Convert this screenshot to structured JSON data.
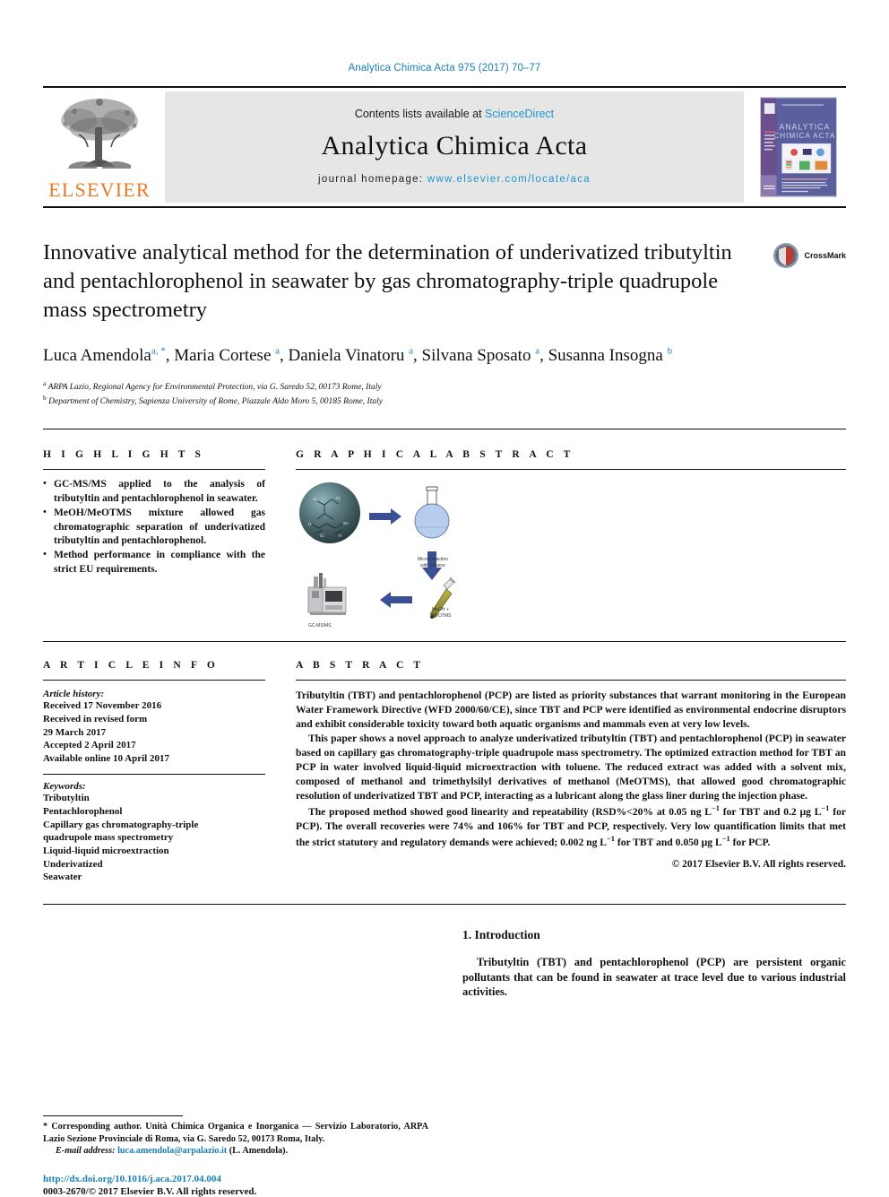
{
  "running_head": "Analytica Chimica Acta 975 (2017) 70–77",
  "masthead": {
    "elsevier_wordmark": "ELSEVIER",
    "contents_prefix": "Contents lists available at ",
    "contents_link": "ScienceDirect",
    "journal_name": "Analytica Chimica Acta",
    "homepage_prefix": "journal homepage: ",
    "homepage_url": "www.elsevier.com/locate/aca",
    "cover_title_line1": "ANALYTICA",
    "cover_title_line2": "CHIMICA ACTA"
  },
  "article": {
    "title": "Innovative analytical method for the determination of underivatized tributyltin and pentachlorophenol in seawater by gas chromatography-triple quadrupole mass spectrometry",
    "crossmark_label": "CrossMark",
    "authors_line1": "Luca Amendola",
    "authors_line1_sup": "a, *",
    "authors_rest": ", Maria Cortese ",
    "author2_sup": "a",
    "author3": ", Daniela Vinatoru ",
    "author3_sup": "a",
    "author4": ", Silvana Sposato ",
    "author4_sup": "a",
    "author5": ", Susanna Insogna ",
    "author5_sup": "b",
    "affiliations": [
      {
        "marker": "a",
        "text": "ARPA Lazio, Regional Agency for Environmental Protection, via G. Saredo 52, 00173 Rome, Italy"
      },
      {
        "marker": "b",
        "text": "Department of Chemistry, Sapienza University of Rome, Piazzale Aldo Moro 5, 00185 Rome, Italy"
      }
    ]
  },
  "highlights": {
    "heading": "H I G H L I G H T S",
    "items": [
      "GC-MS/MS applied to the analysis of tributyltin and pentachlorophenol in seawater.",
      "MeOH/MeOTMS mixture allowed gas chromatographic separation of underivatized tributyltin and pentachlorophenol.",
      "Method performance in compliance with the strict EU requirements."
    ]
  },
  "graphical_abstract": {
    "heading": "G R A P H I C A L  A B S T R A C T",
    "labels": {
      "flask": "Microextraction\nwith Toluene",
      "vial": "MeOH +\nMeOTMS",
      "instrument": "GC-MS/MS"
    }
  },
  "article_info": {
    "heading": "A R T I C L E  I N F O",
    "history_label": "Article history:",
    "history": [
      "Received 17 November 2016",
      "Received in revised form",
      "29 March 2017",
      "Accepted 2 April 2017",
      "Available online 10 April 2017"
    ],
    "keywords_label": "Keywords:",
    "keywords": [
      "Tributyltin",
      "Pentachlorophenol",
      "Capillary gas chromatography-triple",
      "quadrupole mass spectrometry",
      "Liquid-liquid microextraction",
      "Underivatized",
      "Seawater"
    ]
  },
  "abstract": {
    "heading": "A B S T R A C T",
    "paragraph1": "Tributyltin (TBT) and pentachlorophenol (PCP) are listed as priority substances that warrant monitoring in the European Water Framework Directive (WFD 2000/60/CE), since TBT and PCP were identified as environmental endocrine disruptors and exhibit considerable toxicity toward both aquatic organisms and mammals even at very low levels.",
    "paragraph2": "This paper shows a novel approach to analyze underivatized tributyltin (TBT) and pentachlorophenol (PCP) in seawater based on capillary gas chromatography-triple quadrupole mass spectrometry. The optimized extraction method for TBT an PCP in water involved liquid-liquid microextraction with toluene. The reduced extract was added with a solvent mix, composed of methanol and trimethylsilyl derivatives of methanol (MeOTMS), that allowed good chromatographic resolution of underivatized TBT and PCP, interacting as a lubricant along the glass liner during the injection phase.",
    "paragraph3_a": "The proposed method showed good linearity and repeatability (RSD%<20% at 0.05 ng L",
    "paragraph3_b": " for TBT and 0.2 µg L",
    "paragraph3_c": " for PCP). The overall recoveries were 74% and 106% for TBT and PCP, respectively. Very low quantification limits that met the strict statutory and regulatory demands were achieved; 0.002 ng L",
    "paragraph3_d": " for TBT and 0.050 µg L",
    "paragraph3_e": " for PCP.",
    "superscript": "−1",
    "copyright": "© 2017 Elsevier B.V. All rights reserved."
  },
  "introduction": {
    "heading": "1. Introduction",
    "paragraph": "Tributyltin (TBT) and pentachlorophenol (PCP) are persistent organic pollutants that can be found in seawater at trace level due to various industrial activities."
  },
  "footer": {
    "corresponding_marker": "*",
    "corresponding_text": "Corresponding author. Unità Chimica Organica e Inorganica — Servizio Laboratorio, ARPA Lazio Sezione Provinciale di Roma, via G. Saredo 52, 00173 Roma, Italy.",
    "email_label": "E-mail address:",
    "email": "luca.amendola@arpalazio.it",
    "email_owner": "(L. Amendola).",
    "doi": "http://dx.doi.org/10.1016/j.aca.2017.04.004",
    "issn_line": "0003-2670/© 2017 Elsevier B.V. All rights reserved."
  },
  "colors": {
    "link_blue": "#1a7fb5",
    "sciencedirect_blue": "#2196c9",
    "elsevier_orange": "#E87722",
    "arrow_blue": "#3b4f96",
    "masthead_gray": "#e6e6e6"
  }
}
